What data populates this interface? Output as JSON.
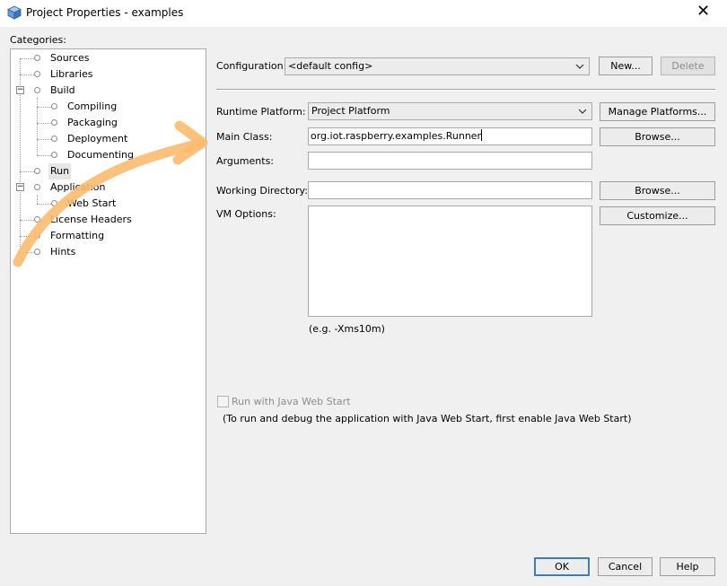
{
  "window": {
    "title": "Project Properties - examples",
    "close_glyph": "✕"
  },
  "categories": {
    "label": "Categories:",
    "items": [
      {
        "label": "Sources"
      },
      {
        "label": "Libraries"
      },
      {
        "label": "Build",
        "expander": "−"
      },
      {
        "label": "Compiling"
      },
      {
        "label": "Packaging"
      },
      {
        "label": "Deployment"
      },
      {
        "label": "Documenting"
      },
      {
        "label": "Run",
        "selected": true
      },
      {
        "label": "Application",
        "expander": "−"
      },
      {
        "label": "Web Start"
      },
      {
        "label": "License Headers"
      },
      {
        "label": "Formatting"
      },
      {
        "label": "Hints"
      }
    ]
  },
  "configuration": {
    "label": "Configuration:",
    "value": "<default config>",
    "new_label": "New...",
    "delete_label": "Delete"
  },
  "run": {
    "runtime_platform_label": "Runtime Platform:",
    "runtime_platform_value": "Project Platform",
    "manage_platforms_label": "Manage Platforms...",
    "main_class_label": "Main Class:",
    "main_class_value": "org.iot.raspberry.examples.Runner",
    "browse_label": "Browse...",
    "arguments_label": "Arguments:",
    "arguments_value": "",
    "working_dir_label": "Working Directory:",
    "working_dir_value": "",
    "browse2_label": "Browse...",
    "vm_options_label": "VM Options:",
    "vm_options_value": "",
    "customize_label": "Customize...",
    "vm_hint": "(e.g. -Xms10m)",
    "web_start_checkbox_label": "Run with Java Web Start",
    "web_start_checked": false,
    "web_start_note": "(To run and debug the application with Java Web Start, first enable Java Web Start)"
  },
  "footer": {
    "ok_label": "OK",
    "cancel_label": "Cancel",
    "help_label": "Help"
  },
  "annotation": {
    "arrow_color": "#f9bb6f"
  }
}
